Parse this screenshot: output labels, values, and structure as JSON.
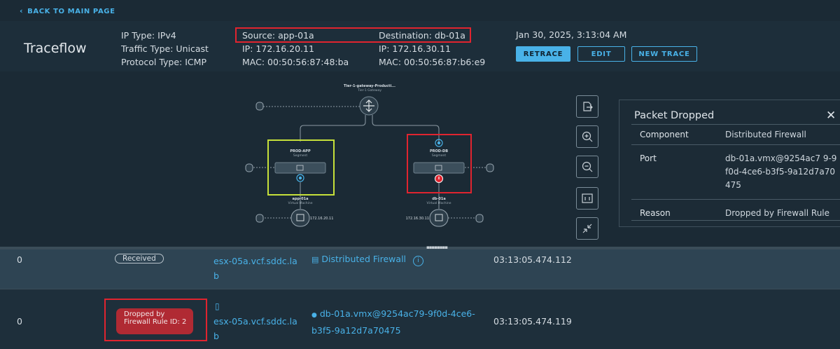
{
  "nav": {
    "back": "BACK TO MAIN PAGE"
  },
  "header": {
    "title": "Traceflow",
    "ip_type": "IP Type: IPv4",
    "traffic_type": "Traffic Type: Unicast",
    "protocol_type": "Protocol Type: ICMP",
    "source": "Source: app-01a",
    "source_ip": "IP: 172.16.20.11",
    "source_mac": "MAC: 00:50:56:87:48:ba",
    "destination": "Destination: db-01a",
    "destination_ip": "IP: 172.16.30.11",
    "destination_mac": "MAC: 00:50:56:87:b6:e9",
    "timestamp": "Jan 30, 2025, 3:13:04 AM",
    "buttons": {
      "retrace": "RETRACE",
      "edit": "EDIT",
      "new_trace": "NEW TRACE"
    }
  },
  "topology": {
    "gateway_name": "Tier-1-gateway-Producti...",
    "gateway_type": "Tier-1 Gateway",
    "segment_app": "PROD-APP",
    "segment_db": "PROD-DB",
    "segment_type": "Segment",
    "vm_app": "app-01a",
    "vm_db": "db-01a",
    "vm_type": "Virtual Machine",
    "vm_app_ip": "172.16.20.11",
    "vm_db_ip": "172.16.30.11"
  },
  "panel": {
    "title": "Packet Dropped",
    "rows": [
      {
        "key": "Component",
        "value": "Distributed Firewall"
      },
      {
        "key": "Port",
        "value": "db-01a.vmx@9254ac7 9-9f0d-4ce6-b3f5-9a12d7a70475"
      },
      {
        "key": "Reason",
        "value": "Dropped by Firewall Rule"
      }
    ]
  },
  "table": {
    "rows": [
      {
        "hop": "0",
        "status": "Received",
        "transport_node": "esx-05a.vcf.sddc.la b",
        "component": "Distributed Firewall",
        "time": "03:13:05.474.112"
      },
      {
        "hop": "0",
        "status": "Dropped by Firewall Rule ID: 2",
        "transport_node": "esx-05a.vcf.sddc.la b",
        "component": "db-01a.vmx@9254ac79-9f0d-4ce6- b3f5-9a12d7a70475",
        "time": "03:13:05.474.119"
      }
    ]
  },
  "colors": {
    "accent": "#49b2e8",
    "highlight_red": "#e0242f",
    "highlight_green": "#c6e03a",
    "drop_badge": "#b02a33"
  }
}
